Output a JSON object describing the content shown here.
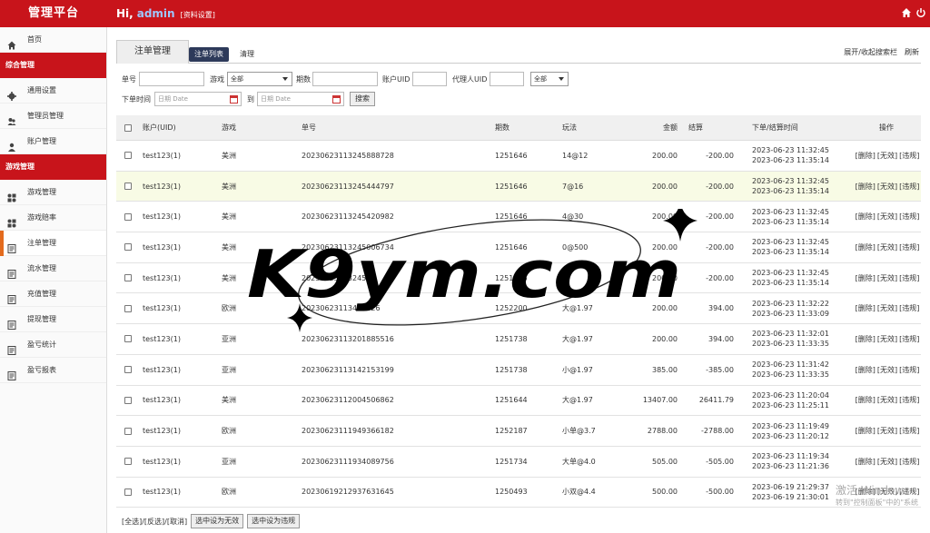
{
  "topbar": {
    "brand": "管理平台",
    "greeting": "Hi,",
    "user": "admin",
    "profile_link": "[资料设置]"
  },
  "sidebar": {
    "items": [
      {
        "label": "首页",
        "icon": "home-icon",
        "type": "item"
      },
      {
        "label": "综合管理",
        "type": "section"
      },
      {
        "label": "通用设置",
        "icon": "gear-icon",
        "type": "item"
      },
      {
        "label": "管理员管理",
        "icon": "admin-users-icon",
        "type": "item"
      },
      {
        "label": "账户管理",
        "icon": "user-icon",
        "type": "item"
      },
      {
        "label": "游戏管理",
        "type": "section"
      },
      {
        "label": "游戏管理",
        "icon": "grid-icon",
        "type": "item"
      },
      {
        "label": "游戏赔率",
        "icon": "grid-icon",
        "type": "item"
      },
      {
        "label": "注单管理",
        "icon": "document-icon",
        "type": "item",
        "active": true
      },
      {
        "label": "流水管理",
        "icon": "document-icon",
        "type": "item"
      },
      {
        "label": "充值管理",
        "icon": "document-icon",
        "type": "item"
      },
      {
        "label": "提现管理",
        "icon": "document-icon",
        "type": "item"
      },
      {
        "label": "盈亏统计",
        "icon": "document-icon",
        "type": "item"
      },
      {
        "label": "盈亏报表",
        "icon": "document-icon",
        "type": "item"
      }
    ]
  },
  "tabs": {
    "title": "注单管理",
    "list": "注单列表",
    "clear": "清理",
    "toggle_search": "展开/收起搜索栏",
    "refresh": "刷新"
  },
  "filters": {
    "order_no": "单号",
    "game": "游戏",
    "game_value": "全部",
    "period": "期数",
    "account_uid": "账户UID",
    "agent_uid": "代理人UID",
    "agent_select": "全部",
    "order_time": "下单时间",
    "date_placeholder": "日期 Date",
    "to": "到",
    "search_button": "搜索"
  },
  "table": {
    "headers": {
      "account": "账户(UID)",
      "game": "游戏",
      "order_no": "单号",
      "period": "期数",
      "play": "玩法",
      "amount": "金额",
      "settle": "结算",
      "time": "下单/结算时间",
      "ops": "操作"
    },
    "rows": [
      {
        "account": "test123(1)",
        "game": "美洲",
        "order_no": "20230623113245888728",
        "period": "1251646",
        "play": "14@12",
        "amount": "200.00",
        "settle": "-200.00",
        "t1": "2023-06-23 11:32:45",
        "t2": "2023-06-23 11:35:14"
      },
      {
        "account": "test123(1)",
        "game": "美洲",
        "order_no": "20230623113245444797",
        "period": "1251646",
        "play": "7@16",
        "amount": "200.00",
        "settle": "-200.00",
        "t1": "2023-06-23 11:32:45",
        "t2": "2023-06-23 11:35:14",
        "highlight": true
      },
      {
        "account": "test123(1)",
        "game": "美洲",
        "order_no": "20230623113245420982",
        "period": "1251646",
        "play": "4@30",
        "amount": "200.00",
        "settle": "-200.00",
        "t1": "2023-06-23 11:32:45",
        "t2": "2023-06-23 11:35:14"
      },
      {
        "account": "test123(1)",
        "game": "美洲",
        "order_no": "20230623113245006734",
        "period": "1251646",
        "play": "0@500",
        "amount": "200.00",
        "settle": "-200.00",
        "t1": "2023-06-23 11:32:45",
        "t2": "2023-06-23 11:35:14"
      },
      {
        "account": "test123(1)",
        "game": "美洲",
        "order_no": "20230623113245",
        "period": "1251646",
        "play": "大",
        "amount": "200.00",
        "settle": "-200.00",
        "t1": "2023-06-23 11:32:45",
        "t2": "2023-06-23 11:35:14"
      },
      {
        "account": "test123(1)",
        "game": "欧洲",
        "order_no": "20230623113493826",
        "period": "1252200",
        "play": "大@1.97",
        "amount": "200.00",
        "settle": "394.00",
        "t1": "2023-06-23 11:32:22",
        "t2": "2023-06-23 11:33:09"
      },
      {
        "account": "test123(1)",
        "game": "亚洲",
        "order_no": "20230623113201885516",
        "period": "1251738",
        "play": "大@1.97",
        "amount": "200.00",
        "settle": "394.00",
        "t1": "2023-06-23 11:32:01",
        "t2": "2023-06-23 11:33:35"
      },
      {
        "account": "test123(1)",
        "game": "亚洲",
        "order_no": "20230623113142153199",
        "period": "1251738",
        "play": "小@1.97",
        "amount": "385.00",
        "settle": "-385.00",
        "t1": "2023-06-23 11:31:42",
        "t2": "2023-06-23 11:33:35"
      },
      {
        "account": "test123(1)",
        "game": "美洲",
        "order_no": "20230623112004506862",
        "period": "1251644",
        "play": "大@1.97",
        "amount": "13407.00",
        "settle": "26411.79",
        "t1": "2023-06-23 11:20:04",
        "t2": "2023-06-23 11:25:11"
      },
      {
        "account": "test123(1)",
        "game": "欧洲",
        "order_no": "20230623111949366182",
        "period": "1252187",
        "play": "小单@3.7",
        "amount": "2788.00",
        "settle": "-2788.00",
        "t1": "2023-06-23 11:19:49",
        "t2": "2023-06-23 11:20:12"
      },
      {
        "account": "test123(1)",
        "game": "亚洲",
        "order_no": "20230623111934089756",
        "period": "1251734",
        "play": "大单@4.0",
        "amount": "505.00",
        "settle": "-505.00",
        "t1": "2023-06-23 11:19:34",
        "t2": "2023-06-23 11:21:36"
      },
      {
        "account": "test123(1)",
        "game": "欧洲",
        "order_no": "20230619212937631645",
        "period": "1250493",
        "play": "小双@4.4",
        "amount": "500.00",
        "settle": "-500.00",
        "t1": "2023-06-19 21:29:37",
        "t2": "2023-06-19 21:30:01"
      }
    ],
    "ops": {
      "delete": "[删除]",
      "invalid": "[无效]",
      "violation": "[违规]"
    }
  },
  "footer": {
    "select": "[全选]/[反选]/[取消]",
    "set_invalid": "选中设为无效",
    "set_violation": "选中设为违规"
  },
  "watermark": {
    "text": "K9ym.com"
  },
  "windows_activation": {
    "title": "激活 Windows",
    "hint": "转到\"控制面板\"中的\"系统"
  },
  "colors": {
    "brand_red": "#c8141b",
    "tab_dark": "#2d3a5a",
    "active_marker": "#e36b1e"
  }
}
